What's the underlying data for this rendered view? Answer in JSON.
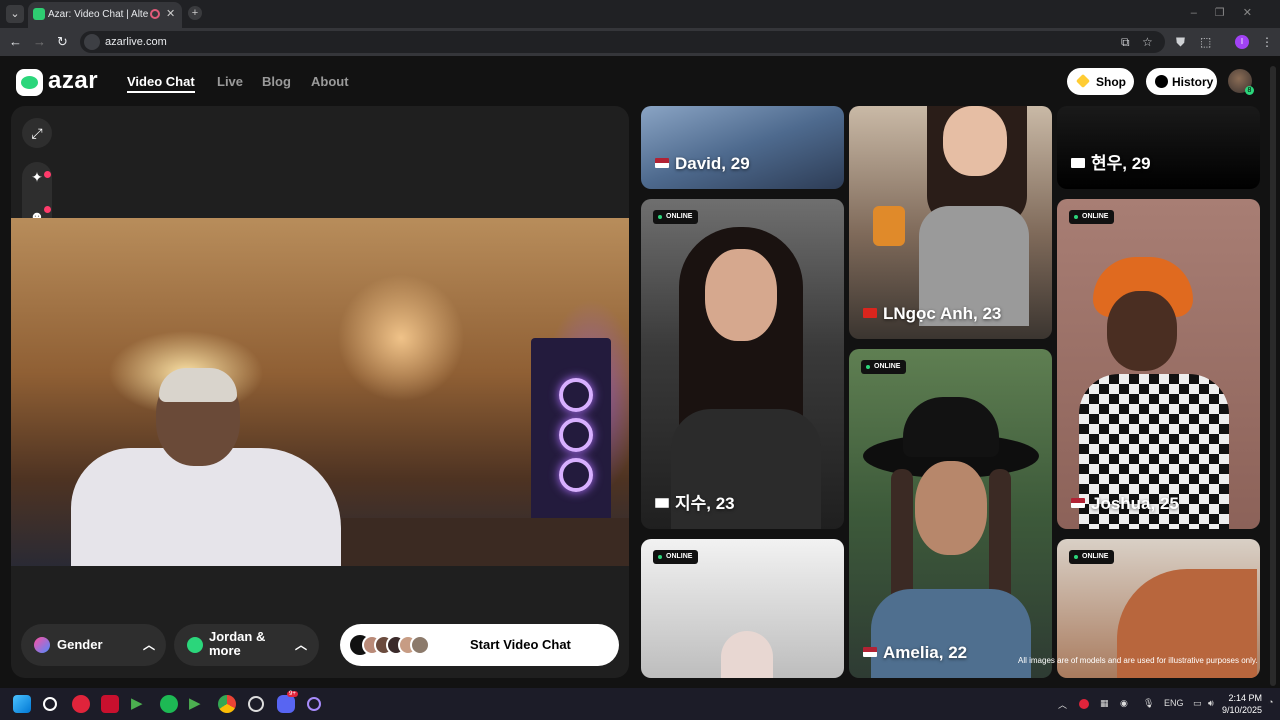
{
  "browser": {
    "tab_title": "Azar: Video Chat | Alternati",
    "tab_close": "✕",
    "new_tab": "+",
    "url": "azarlive.com"
  },
  "site": {
    "logo_text": "azar",
    "nav": [
      {
        "label": "Video Chat",
        "active": true
      },
      {
        "label": "Live",
        "active": false
      },
      {
        "label": "Blog",
        "active": false
      },
      {
        "label": "About",
        "active": false
      }
    ],
    "shop_label": "Shop",
    "history_label": "History",
    "user_badge": "8"
  },
  "video_panel": {
    "gender_label": "Gender",
    "region_label_line1": "Jordan &",
    "region_label_line2": "more",
    "start_label": "Start Video Chat"
  },
  "gallery": {
    "cards": [
      {
        "name": "David, 29",
        "flag": "us",
        "online": false
      },
      {
        "name": "LNgọc Anh, 23",
        "flag": "vn",
        "online": false
      },
      {
        "name": "현우, 29",
        "flag": "kr",
        "online": false
      },
      {
        "name": "지수, 23",
        "flag": "kr",
        "online": true
      },
      {
        "name": "Amelia, 22",
        "flag": "us",
        "online": true
      },
      {
        "name": "Joshua, 25",
        "flag": "us",
        "online": true
      },
      {
        "name": "",
        "flag": "",
        "online": true
      },
      {
        "name": "",
        "flag": "",
        "online": true
      }
    ],
    "online_label": "ONLINE",
    "disclaimer": "All images are of models and are used for illustrative purposes only."
  },
  "taskbar": {
    "language": "ENG",
    "time": "2:14 PM",
    "date": "9/10/2025",
    "discord_badge": "9+"
  },
  "colors": {
    "accent_green": "#2bd67b",
    "notification_red": "#ff3b6b"
  }
}
